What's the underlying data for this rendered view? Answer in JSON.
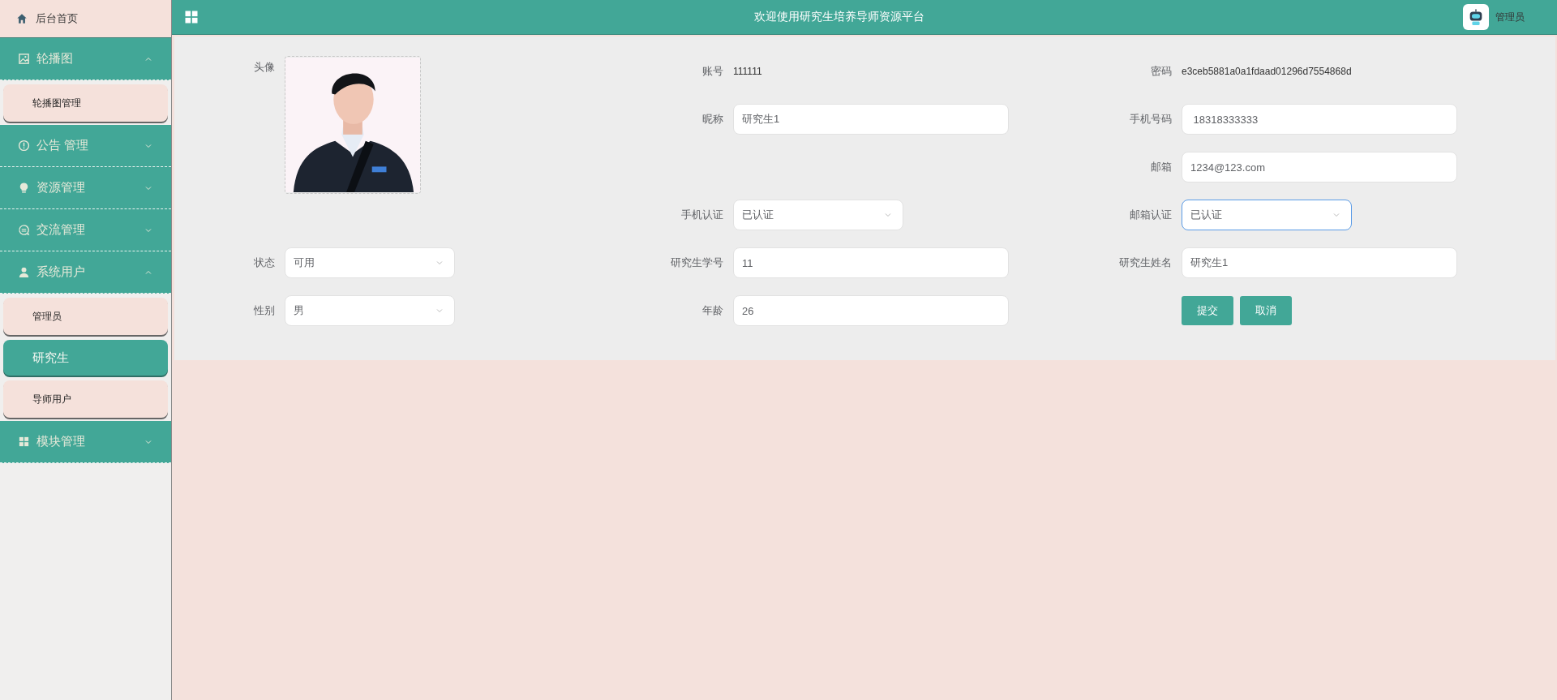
{
  "sidebar": {
    "home": {
      "label": "后台首页"
    },
    "groups": [
      {
        "label": "轮播图",
        "expanded": true,
        "items": [
          {
            "label": "轮播图管理",
            "selected": false
          }
        ]
      },
      {
        "label": "公告 管理",
        "expanded": false
      },
      {
        "label": "资源管理",
        "expanded": false
      },
      {
        "label": "交流管理",
        "expanded": false
      },
      {
        "label": "系统用户",
        "expanded": true,
        "items": [
          {
            "label": "管理员",
            "selected": false
          },
          {
            "label": "研究生",
            "selected": true
          },
          {
            "label": "导师用户",
            "selected": false
          }
        ]
      },
      {
        "label": "模块管理",
        "expanded": false
      }
    ]
  },
  "topbar": {
    "title": "欢迎使用研究生培养导师资源平台",
    "user": "管理员"
  },
  "form": {
    "columns": [
      {
        "fields": [
          {
            "kind": "avatar",
            "label": "头像"
          },
          {
            "kind": "select",
            "label": "状态",
            "value": "可用",
            "focused": false
          },
          {
            "kind": "select",
            "label": "性别",
            "value": "男",
            "focused": false
          }
        ]
      },
      {
        "fields": [
          {
            "kind": "text",
            "label": "账号",
            "value": "111111"
          },
          {
            "kind": "input",
            "label": "昵称",
            "value": "研究生1"
          },
          {
            "kind": "select",
            "label": "手机认证",
            "value": "已认证",
            "focused": false
          },
          {
            "kind": "input",
            "label": "研究生学号",
            "value": "11"
          },
          {
            "kind": "input",
            "label": "年龄",
            "value": "26"
          }
        ]
      },
      {
        "fields": [
          {
            "kind": "text",
            "label": "密码",
            "value": "e3ceb5881a0a1fdaad01296d7554868d"
          },
          {
            "kind": "input",
            "label": "手机号码",
            "value": " 18318333333"
          },
          {
            "kind": "input",
            "label": "邮箱",
            "value": "1234@123.com"
          },
          {
            "kind": "select",
            "label": "邮箱认证",
            "value": "已认证",
            "focused": true
          },
          {
            "kind": "input",
            "label": "研究生姓名",
            "value": "研究生1"
          },
          {
            "kind": "buttons",
            "buttons": [
              "提交",
              "取消"
            ]
          }
        ]
      }
    ]
  }
}
